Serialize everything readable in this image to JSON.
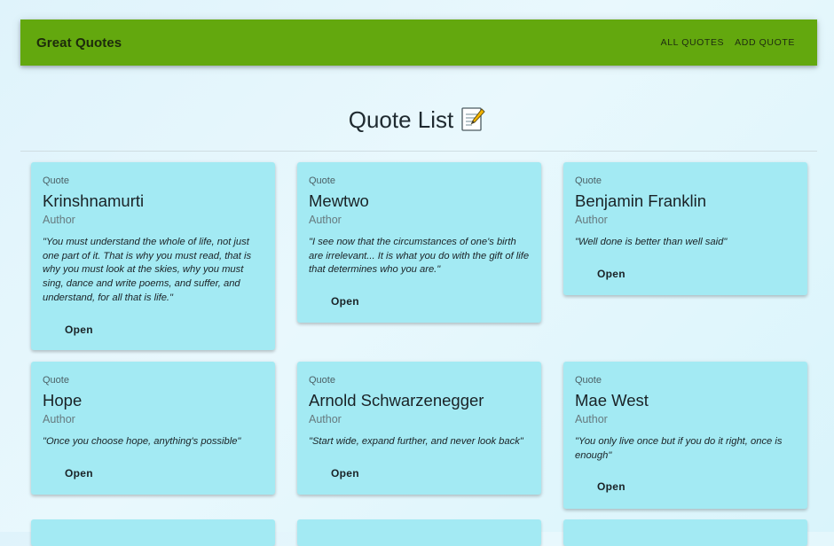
{
  "appbar": {
    "brand": "Great Quotes",
    "nav": [
      "ALL QUOTES",
      "ADD QUOTE"
    ],
    "color": "#63a80e"
  },
  "page": {
    "title": "Quote List",
    "title_icon": "memo-icon"
  },
  "quotes": [
    {
      "kicker": "Quote",
      "name": "Krinshnamurti",
      "role": "Author",
      "text": "\"You must understand the whole of life, not just one part of it. That is why you must read, that is why you must look at the skies, why you must sing, dance and write poems, and suffer, and understand, for all that is life.\"",
      "action": "Open"
    },
    {
      "kicker": "Quote",
      "name": "Mewtwo",
      "role": "Author",
      "text": "\"I see now that the circumstances of one's birth are irrelevant... It is what you do with the gift of life that determines who you are.\"",
      "action": "Open"
    },
    {
      "kicker": "Quote",
      "name": "Benjamin Franklin",
      "role": "Author",
      "text": "\"Well done is better than well said\"",
      "action": "Open"
    },
    {
      "kicker": "Quote",
      "name": "Hope",
      "role": "Author",
      "text": "\"Once you choose hope, anything's possible\"",
      "action": "Open"
    },
    {
      "kicker": "Quote",
      "name": "Arnold Schwarzenegger",
      "role": "Author",
      "text": "\"Start wide, expand further, and never look back\"",
      "action": "Open"
    },
    {
      "kicker": "Quote",
      "name": "Mae West",
      "role": "Author",
      "text": "\"You only live once but if you do it right, once is enough\"",
      "action": "Open"
    }
  ],
  "colors": {
    "card": "#a3eaf3",
    "background": "#e4f6fc"
  }
}
